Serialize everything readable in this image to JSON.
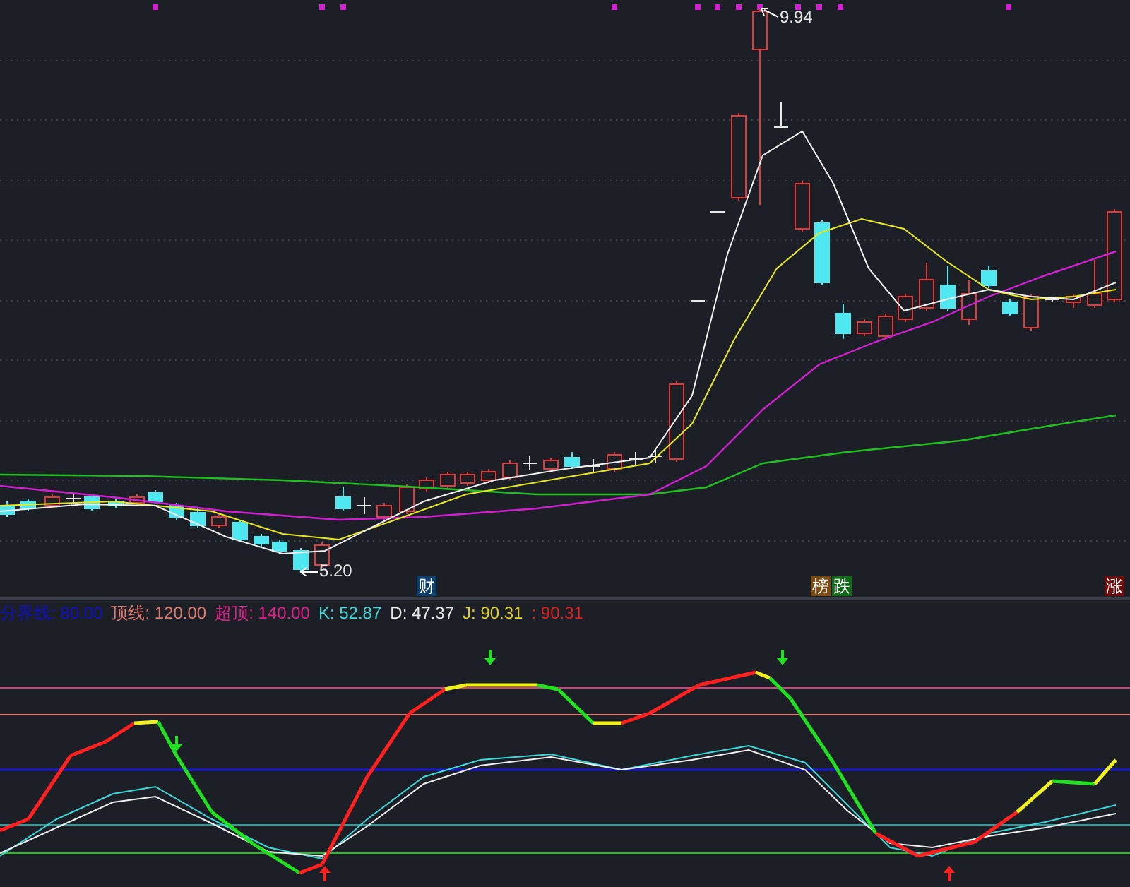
{
  "price_labels": [
    {
      "kind": "high",
      "text": "9.94"
    },
    {
      "kind": "low",
      "text": "5.20"
    }
  ],
  "tags": [
    {
      "text": "财",
      "color": "#0b3f6e"
    },
    {
      "text": "榜",
      "color": "#7a4a10"
    },
    {
      "text": "跌",
      "color": "#0f6b16"
    },
    {
      "text": "涨",
      "color": "#6e0d0d"
    }
  ],
  "legend": [
    {
      "text": "分界线: 80.00",
      "color": "#1010c8"
    },
    {
      "text": "顶线: 120.00",
      "color": "#e07a70"
    },
    {
      "text": "超顶: 140.00",
      "color": "#e0208a"
    },
    {
      "text": "K: 52.87",
      "color": "#3fd8d8"
    },
    {
      "text": "D: 47.37",
      "color": "#e8e8e8"
    },
    {
      "text": "J: 90.31",
      "color": "#e0d020"
    },
    {
      "text": ": 90.31",
      "color": "#e02020"
    }
  ]
}
